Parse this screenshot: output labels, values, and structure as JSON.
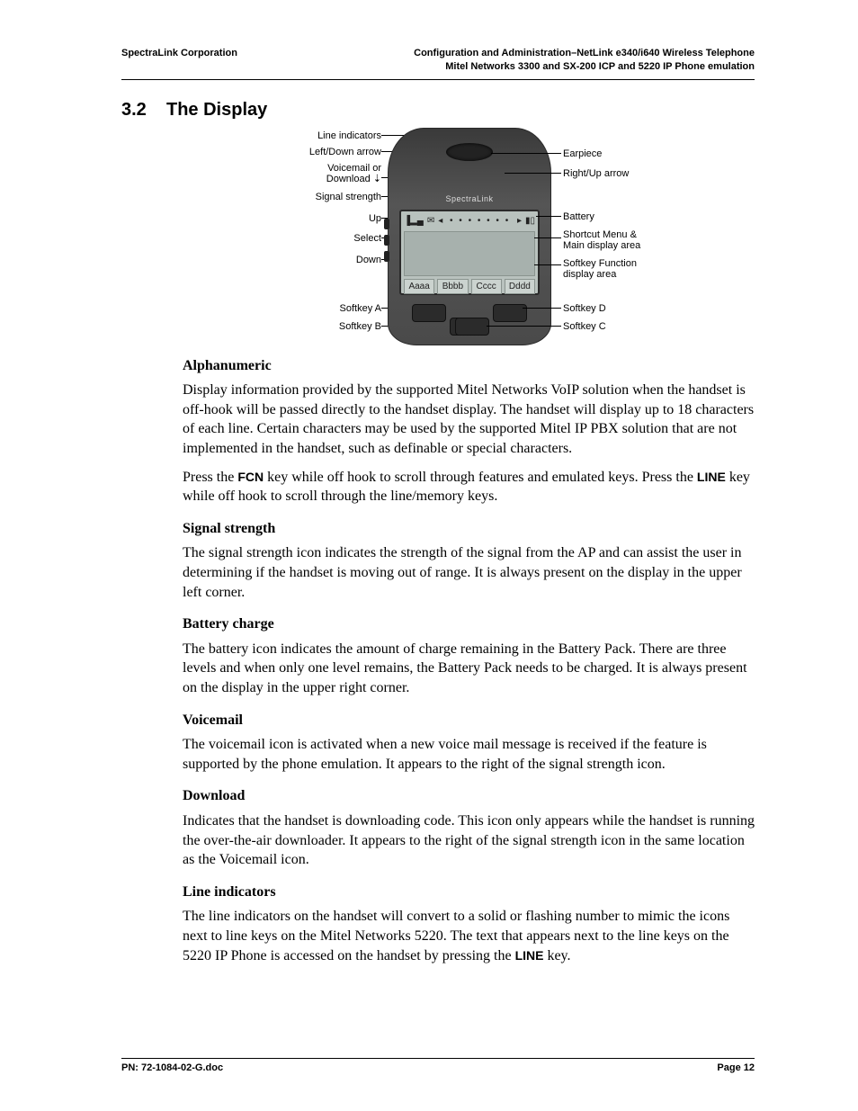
{
  "header": {
    "left": "SpectraLink Corporation",
    "right1": "Configuration and Administration–NetLink e340/i640 Wireless Telephone",
    "right2": "Mitel Networks 3300 and SX-200 ICP and 5220 IP Phone emulation"
  },
  "section": {
    "num": "3.2",
    "title": "The Display"
  },
  "diagram": {
    "left_labels": {
      "line_indicators": "Line indicators",
      "left_down": "Left/Down arrow",
      "voicemail_dl_a": "Voicemail or",
      "voicemail_dl_b": "Download",
      "signal": "Signal strength",
      "up": "Up",
      "select": "Select",
      "down": "Down",
      "softkey_a": "Softkey A",
      "softkey_b": "Softkey B"
    },
    "right_labels": {
      "earpiece": "Earpiece",
      "right_up": "Right/Up arrow",
      "battery": "Battery",
      "shortcut_a": "Shortcut Menu &",
      "shortcut_b": "Main display area",
      "softfn_a": "Softkey Function",
      "softfn_b": "display area",
      "softkey_d": "Softkey D",
      "softkey_c": "Softkey C"
    },
    "screen": {
      "brand": "SpectraLink",
      "softkeys": [
        "Aaaa",
        "Bbbb",
        "Cccc",
        "Dddd"
      ],
      "signal_glyph": "▐▂▄",
      "mail_glyph": "✉",
      "left_glyph": "◂",
      "right_glyph": "▸",
      "batt_glyph": "▮▯",
      "dots": "• • • • • • •"
    }
  },
  "body": {
    "alphanumeric_h": "Alphanumeric",
    "alphanumeric_p": "Display information provided by the supported Mitel Networks VoIP solution when the handset is off-hook will be passed directly to the handset display. The handset will display up to 18 characters of each line. Certain characters may be used by the supported Mitel IP PBX solution that are not implemented in the handset, such as definable or special characters.",
    "press_pre": "Press the ",
    "fcn": "FCN",
    "press_mid1": " key while off hook to scroll through features and emulated keys. Press the ",
    "line_key": "LINE",
    "press_tail": " key while off hook to scroll through the line/memory keys.",
    "signal_h": "Signal strength",
    "signal_p": "The signal strength icon indicates the strength of the signal from the AP and can assist the user in determining if the handset is moving out of range. It is always present on the display in the upper left corner.",
    "battery_h": "Battery charge",
    "battery_p": "The battery icon indicates the amount of charge remaining in the Battery Pack. There are three levels and when only one level remains, the Battery Pack needs to be charged. It is always present on the display in the upper right corner.",
    "voicemail_h": "Voicemail",
    "voicemail_p": "The voicemail icon is activated when a new voice mail message is received if the feature is supported by the phone emulation. It appears to the right of the signal strength icon.",
    "download_h": "Download",
    "download_p": "Indicates that the handset is downloading code. This icon only appears while the handset is running the over-the-air downloader. It appears to the right of the signal strength icon in the same location as the Voicemail icon.",
    "lineind_h": "Line indicators",
    "lineind_p_a": "The line indicators on the handset will convert to a solid or flashing number to mimic the icons next to line keys on the Mitel Networks 5220. The text that appears next to the line keys on the 5220 IP Phone is accessed on the handset by pressing the ",
    "lineind_p_b": " key."
  },
  "footer": {
    "pn": "PN: 72-1084-02-G.doc",
    "page": "Page 12"
  }
}
